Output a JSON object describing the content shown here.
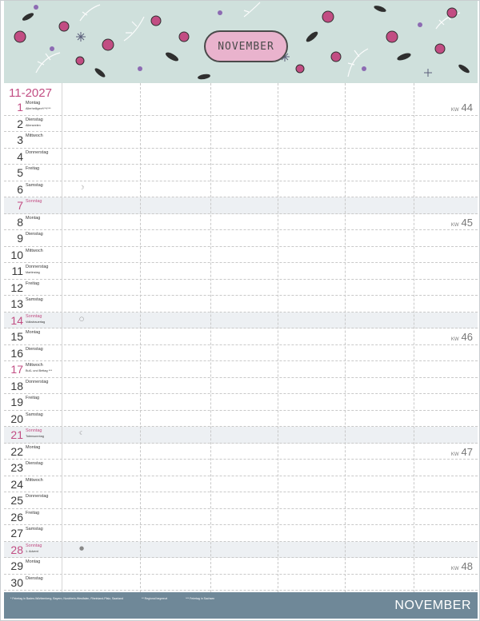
{
  "title": "NOVEMBER",
  "month_year": "11-2027",
  "footer": {
    "month": "NOVEMBER",
    "notes": [
      "* Feiertag in Baden-Württemberg, Bayern, Nordrhein-Westfalen, Rheinland-Pfalz, Saarland",
      "** Regional begrenzt",
      "*** Feiertag in Sachsen"
    ]
  },
  "colors": {
    "banner": "#cfe0dc",
    "plate": "#e9b3cd",
    "accent": "#c24d83",
    "footer": "#6f8898"
  },
  "kw_label": "KW",
  "days": [
    {
      "num": "1",
      "name": "Montag",
      "note": "Allerheiligen*/**/***",
      "type": "hol",
      "moon": "",
      "kw": "44"
    },
    {
      "num": "2",
      "name": "Dienstag",
      "note": "Allerseelen",
      "type": "",
      "moon": "",
      "kw": ""
    },
    {
      "num": "3",
      "name": "Mittwoch",
      "note": "",
      "type": "",
      "moon": "",
      "kw": ""
    },
    {
      "num": "4",
      "name": "Donnerstag",
      "note": "",
      "type": "",
      "moon": "",
      "kw": ""
    },
    {
      "num": "5",
      "name": "Freitag",
      "note": "",
      "type": "",
      "moon": "",
      "kw": ""
    },
    {
      "num": "6",
      "name": "Samstag",
      "note": "",
      "type": "",
      "moon": "☽",
      "kw": ""
    },
    {
      "num": "7",
      "name": "Sonntag",
      "note": "",
      "type": "sun",
      "moon": "",
      "kw": ""
    },
    {
      "num": "8",
      "name": "Montag",
      "note": "",
      "type": "",
      "moon": "",
      "kw": "45"
    },
    {
      "num": "9",
      "name": "Dienstag",
      "note": "",
      "type": "",
      "moon": "",
      "kw": ""
    },
    {
      "num": "10",
      "name": "Mittwoch",
      "note": "",
      "type": "",
      "moon": "",
      "kw": ""
    },
    {
      "num": "11",
      "name": "Donnerstag",
      "note": "Martinstag",
      "type": "",
      "moon": "",
      "kw": ""
    },
    {
      "num": "12",
      "name": "Freitag",
      "note": "",
      "type": "",
      "moon": "",
      "kw": ""
    },
    {
      "num": "13",
      "name": "Samstag",
      "note": "",
      "type": "",
      "moon": "",
      "kw": ""
    },
    {
      "num": "14",
      "name": "Sonntag",
      "note": "Volkstrauertag",
      "type": "sun",
      "moon": "○",
      "kw": ""
    },
    {
      "num": "15",
      "name": "Montag",
      "note": "",
      "type": "",
      "moon": "",
      "kw": "46"
    },
    {
      "num": "16",
      "name": "Dienstag",
      "note": "",
      "type": "",
      "moon": "",
      "kw": ""
    },
    {
      "num": "17",
      "name": "Mittwoch",
      "note": "Buß- und Bettag ***",
      "type": "hol",
      "moon": "",
      "kw": ""
    },
    {
      "num": "18",
      "name": "Donnerstag",
      "note": "",
      "type": "",
      "moon": "",
      "kw": ""
    },
    {
      "num": "19",
      "name": "Freitag",
      "note": "",
      "type": "",
      "moon": "",
      "kw": ""
    },
    {
      "num": "20",
      "name": "Samstag",
      "note": "",
      "type": "",
      "moon": "",
      "kw": ""
    },
    {
      "num": "21",
      "name": "Sonntag",
      "note": "Totensonntag",
      "type": "sun",
      "moon": "☾",
      "kw": ""
    },
    {
      "num": "22",
      "name": "Montag",
      "note": "",
      "type": "",
      "moon": "",
      "kw": "47"
    },
    {
      "num": "23",
      "name": "Dienstag",
      "note": "",
      "type": "",
      "moon": "",
      "kw": ""
    },
    {
      "num": "24",
      "name": "Mittwoch",
      "note": "",
      "type": "",
      "moon": "",
      "kw": ""
    },
    {
      "num": "25",
      "name": "Donnerstag",
      "note": "",
      "type": "",
      "moon": "",
      "kw": ""
    },
    {
      "num": "26",
      "name": "Freitag",
      "note": "",
      "type": "",
      "moon": "",
      "kw": ""
    },
    {
      "num": "27",
      "name": "Samstag",
      "note": "",
      "type": "",
      "moon": "",
      "kw": ""
    },
    {
      "num": "28",
      "name": "Sonntag",
      "note": "1. Advent",
      "type": "sun",
      "moon": "●",
      "kw": ""
    },
    {
      "num": "29",
      "name": "Montag",
      "note": "",
      "type": "",
      "moon": "",
      "kw": "48"
    },
    {
      "num": "30",
      "name": "Dienstag",
      "note": "",
      "type": "",
      "moon": "",
      "kw": ""
    }
  ]
}
